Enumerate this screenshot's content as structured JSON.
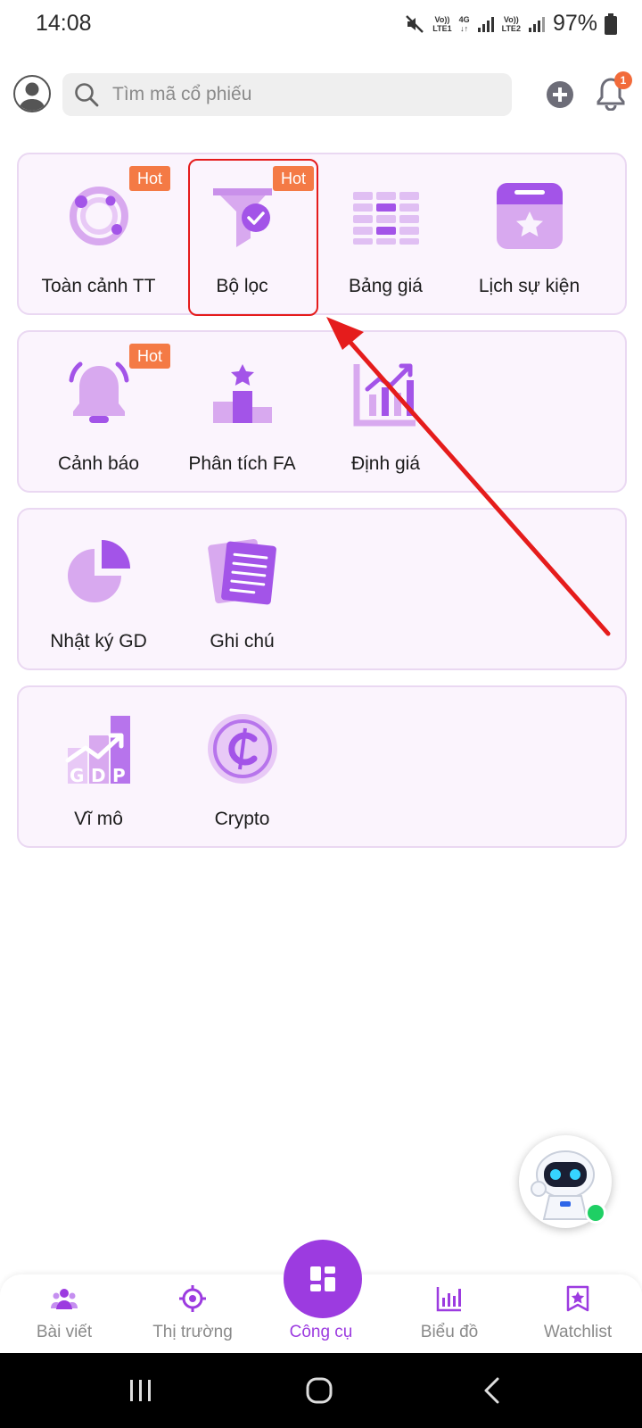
{
  "status_bar": {
    "time": "14:08",
    "net1_top": "Vo))",
    "net1_bottom": "LTE1",
    "net_4g": "4G",
    "net2_top": "Vo))",
    "net2_bottom": "LTE2",
    "battery": "97%"
  },
  "header": {
    "search_placeholder": "Tìm mã cổ phiếu",
    "notification_count": "1"
  },
  "groups": [
    {
      "tiles": [
        {
          "label": "Toàn cảnh TT",
          "hot": "Hot",
          "icon": "orbit-icon"
        },
        {
          "label": "Bộ lọc",
          "hot": "Hot",
          "icon": "filter-icon"
        },
        {
          "label": "Bảng giá",
          "icon": "price-board-icon"
        },
        {
          "label": "Lịch sự kiện",
          "icon": "calendar-star-icon"
        }
      ]
    },
    {
      "tiles": [
        {
          "label": "Cảnh báo",
          "hot": "Hot",
          "icon": "bell-alert-icon"
        },
        {
          "label": "Phân tích FA",
          "icon": "podium-icon"
        },
        {
          "label": "Định giá",
          "icon": "growth-chart-icon"
        }
      ]
    },
    {
      "tiles": [
        {
          "label": "Nhật ký GD",
          "icon": "pie-chart-icon"
        },
        {
          "label": "Ghi chú",
          "icon": "notes-icon"
        }
      ]
    },
    {
      "tiles": [
        {
          "label": "Vĩ mô",
          "icon": "gdp-icon"
        },
        {
          "label": "Crypto",
          "icon": "crypto-icon"
        }
      ]
    }
  ],
  "bottom_nav": [
    {
      "label": "Bài viết",
      "icon": "community-icon"
    },
    {
      "label": "Thị trường",
      "icon": "target-icon"
    },
    {
      "label": "Công cụ",
      "icon": "tools-grid-icon",
      "active": true
    },
    {
      "label": "Biểu đồ",
      "icon": "bar-chart-icon"
    },
    {
      "label": "Watchlist",
      "icon": "bookmark-star-icon"
    }
  ],
  "colors": {
    "accent": "#9c3be0",
    "icon_light": "#d8a9ef",
    "hot_badge": "#f47a45",
    "tile_bg": "#fbf4fd",
    "annotation": "#e51c1c"
  }
}
